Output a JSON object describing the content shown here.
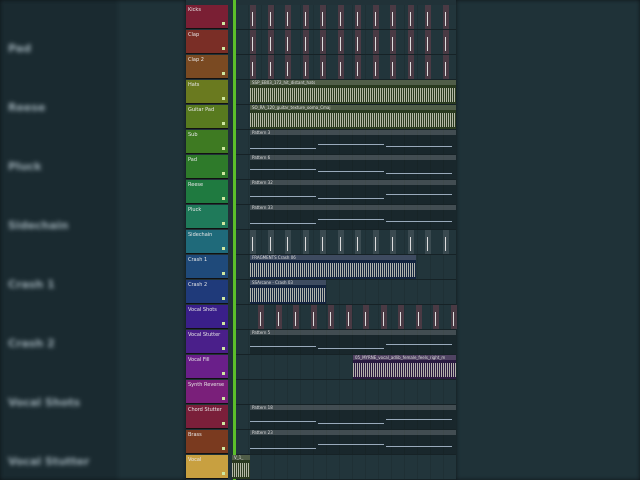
{
  "background_labels": [
    "Pad",
    "Reese",
    "Pluck",
    "Sidechain",
    "Crash 1",
    "Crash 2",
    "Vocal Shots",
    "Vocal Stutter"
  ],
  "tracks": [
    {
      "name": "Kicks",
      "color": "#7a1f34",
      "kind": "hits"
    },
    {
      "name": "Clap",
      "color": "#7a2e26",
      "kind": "hits"
    },
    {
      "name": "Clap 2",
      "color": "#7a4a22",
      "kind": "hits"
    },
    {
      "name": "Hats",
      "color": "#6a7a1f",
      "kind": "audio",
      "clip": "SSP_EB03_172_hit_distant_hats"
    },
    {
      "name": "Guitar Pad",
      "color": "#587a1f",
      "kind": "audio",
      "clip": "SO_RA_120_guitar_texture_ooma_Cmaj"
    },
    {
      "name": "Sub",
      "color": "#3e7a22",
      "kind": "pattern",
      "clip": "Pattern 3"
    },
    {
      "name": "Pad",
      "color": "#2e7a2a",
      "kind": "pattern",
      "clip": "Pattern 6"
    },
    {
      "name": "Reese",
      "color": "#1f7a40",
      "kind": "pattern",
      "clip": "Pattern 32"
    },
    {
      "name": "Pluck",
      "color": "#1f7a5a",
      "kind": "pattern",
      "clip": "Pattern 33"
    },
    {
      "name": "Sidechain",
      "color": "#1f6a7a",
      "kind": "hits"
    },
    {
      "name": "Crash 1",
      "color": "#1f4a7a",
      "kind": "audio",
      "clip": "FRAGMENTS Crash 06"
    },
    {
      "name": "Crash 2",
      "color": "#1f3a7a",
      "kind": "audio",
      "clip": "SSArcane - Crash 03"
    },
    {
      "name": "Vocal Shots",
      "color": "#3a1f8a",
      "kind": "hits"
    },
    {
      "name": "Vocal Stutter",
      "color": "#4a1f8a",
      "kind": "pattern",
      "clip": "Pattern 5"
    },
    {
      "name": "Vocal Fill",
      "color": "#6a1f8a",
      "kind": "audio",
      "clip": "05_MYRNE_vocal_adlib_female_feels_right_m"
    },
    {
      "name": "Synth Reverse",
      "color": "#7a1f7a",
      "kind": "empty"
    },
    {
      "name": "Chord Stutter",
      "color": "#7a1f3a",
      "kind": "pattern",
      "clip": "Pattern 18"
    },
    {
      "name": "Brass",
      "color": "#7a3a1f",
      "kind": "pattern",
      "clip": "Pattern 23"
    },
    {
      "name": "Vocal",
      "color": "#c8a040",
      "kind": "audio",
      "clip": "V_1_"
    }
  ]
}
